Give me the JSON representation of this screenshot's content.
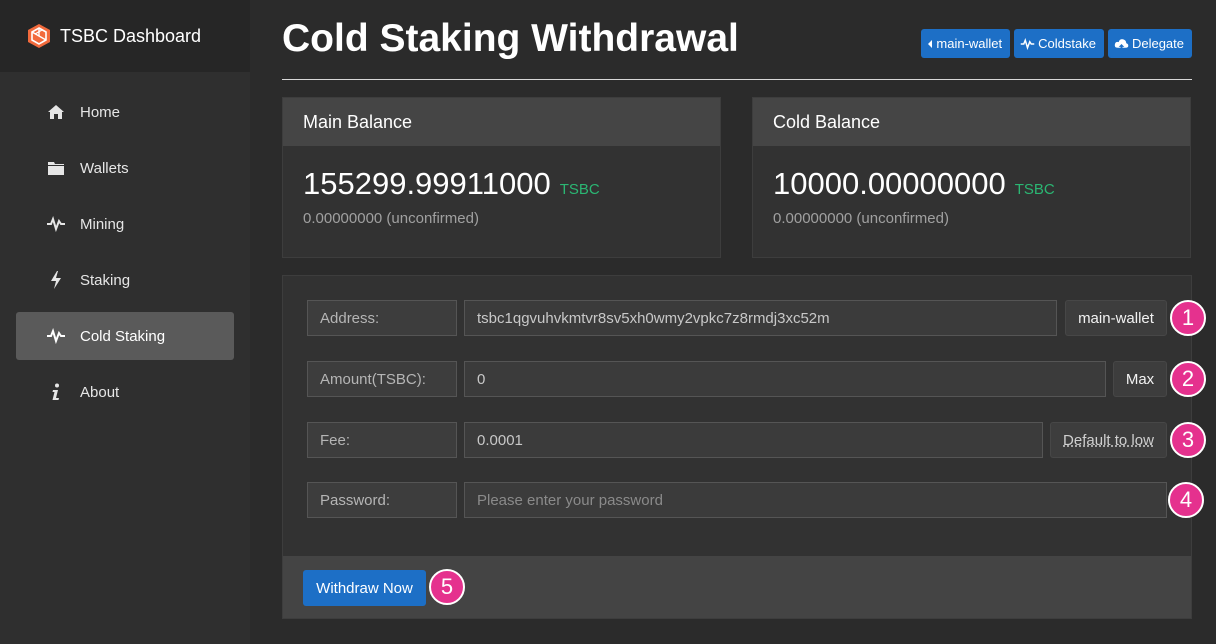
{
  "sidebar": {
    "brand": "TSBC Dashboard",
    "items": [
      {
        "label": "Home",
        "icon": "home-icon"
      },
      {
        "label": "Wallets",
        "icon": "folder-icon"
      },
      {
        "label": "Mining",
        "icon": "pulse-icon"
      },
      {
        "label": "Staking",
        "icon": "bolt-icon"
      },
      {
        "label": "Cold Staking",
        "icon": "pulse-icon",
        "active": true
      },
      {
        "label": "About",
        "icon": "info-icon"
      }
    ]
  },
  "header": {
    "title": "Cold Staking Withdrawal",
    "buttons": [
      {
        "label": "main-wallet",
        "icon": "caret-left-icon"
      },
      {
        "label": "Coldstake",
        "icon": "pulse-icon"
      },
      {
        "label": "Delegate",
        "icon": "cloud-icon"
      }
    ]
  },
  "cards": [
    {
      "title": "Main Balance",
      "value": "155299.99911000",
      "unit": "TSBC",
      "unconfirmed": "0.00000000 (unconfirmed)"
    },
    {
      "title": "Cold Balance",
      "value": "10000.00000000",
      "unit": "TSBC",
      "unconfirmed": "0.00000000 (unconfirmed)"
    }
  ],
  "form": {
    "address": {
      "label": "Address:",
      "value": "tsbc1qgvuhvkmtvr8sv5xh0wmy2vpkc7z8rmdj3xc52m",
      "button": "main-wallet",
      "badge": "1"
    },
    "amount": {
      "label": "Amount(TSBC):",
      "value": "0",
      "button": "Max",
      "badge": "2"
    },
    "fee": {
      "label": "Fee:",
      "value": "0.0001",
      "button": "Default to low",
      "badge": "3"
    },
    "password": {
      "label": "Password:",
      "placeholder": "Please enter your password",
      "badge": "4"
    },
    "submit": {
      "label": "Withdraw Now",
      "badge": "5"
    }
  },
  "colors": {
    "accent": "#1d6fc6",
    "badge": "#e5318e",
    "unit": "#2bb673",
    "sidebar_active": "#5a5a5a"
  }
}
